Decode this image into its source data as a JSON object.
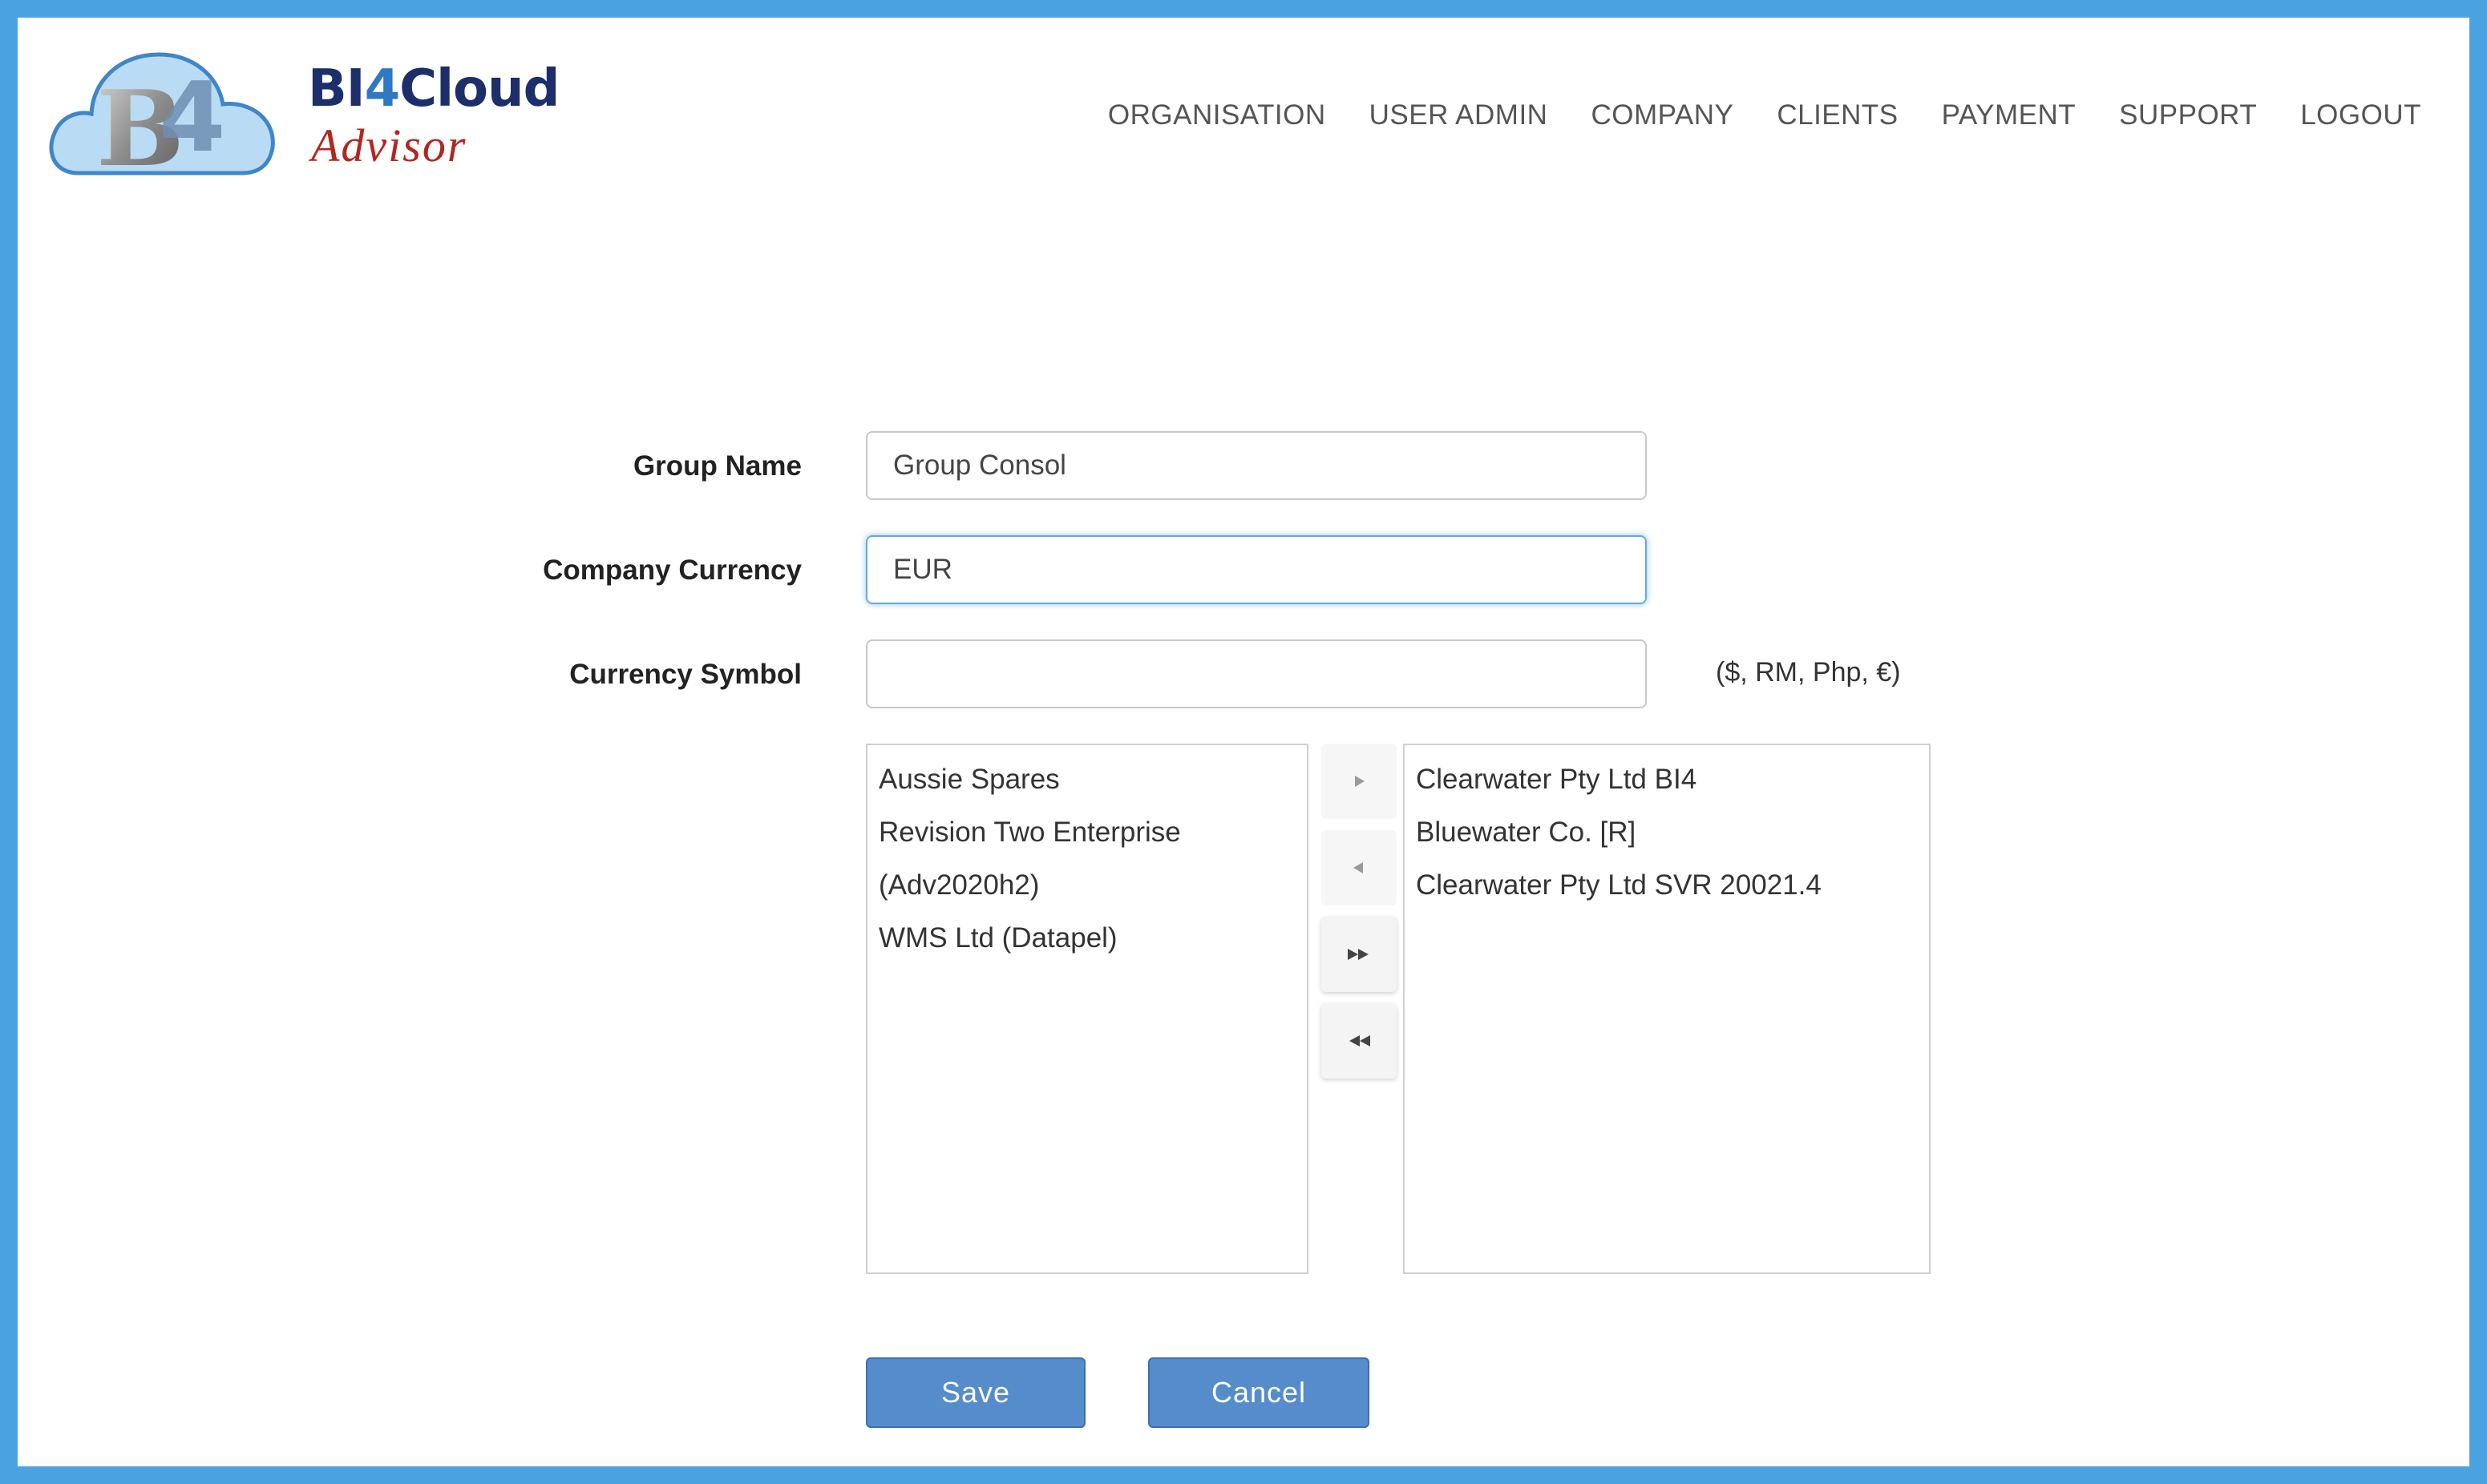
{
  "brand": {
    "logo_text": "B4",
    "name_prefix": "BI",
    "name_four": "4",
    "name_suffix": "Cloud",
    "subtitle": "Advisor"
  },
  "nav": [
    "ORGANISATION",
    "USER ADMIN",
    "COMPANY",
    "CLIENTS",
    "PAYMENT",
    "SUPPORT",
    "LOGOUT"
  ],
  "form": {
    "group_name_label": "Group Name",
    "group_name_value": "Group Consol",
    "currency_label": "Company Currency",
    "currency_value": "EUR",
    "symbol_label": "Currency Symbol",
    "symbol_value": "",
    "symbol_hint": "($, RM, Php, €)"
  },
  "available_companies": [
    "Aussie Spares",
    "Revision Two Enterprise (Adv2020h2)",
    "WMS Ltd (Datapel)"
  ],
  "selected_companies": [
    "Clearwater Pty Ltd BI4",
    "Bluewater Co. [R]",
    "Clearwater Pty Ltd SVR 20021.4"
  ],
  "buttons": {
    "save": "Save",
    "cancel": "Cancel"
  },
  "colors": {
    "frame_border": "#4aa3e0",
    "primary_button": "#558ccc",
    "brand_navy": "#1c2f6b",
    "brand_red": "#b3261e"
  },
  "icons": {
    "move_right": "triangle-right-icon",
    "move_left": "triangle-left-icon",
    "move_all_right": "double-triangle-right-icon",
    "move_all_left": "double-triangle-left-icon"
  }
}
